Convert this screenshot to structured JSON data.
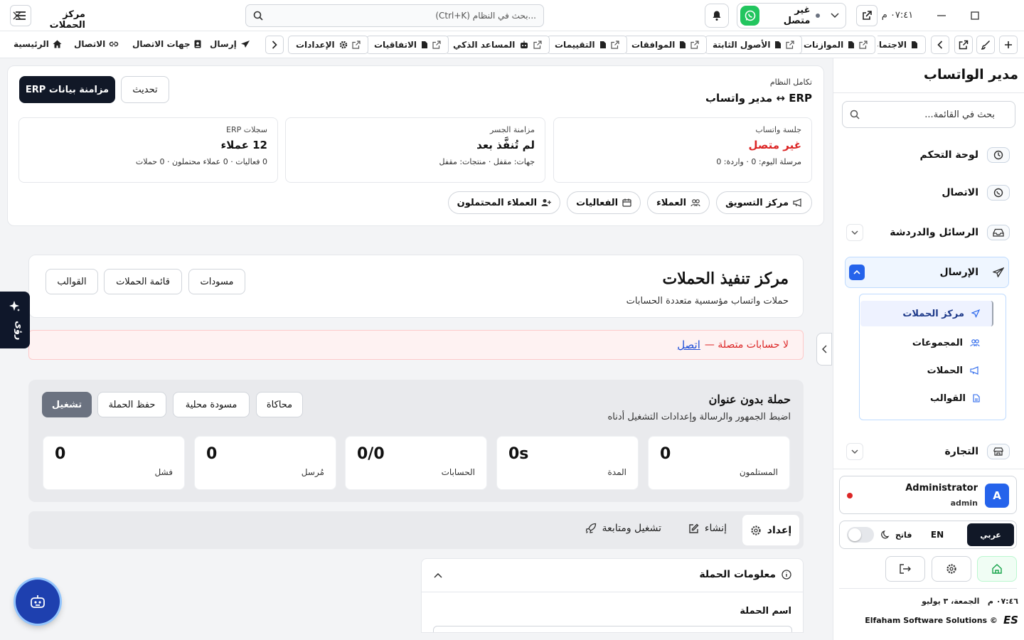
{
  "titlebar": {
    "app_title": "مركز الحملات",
    "search_placeholder": "...بحث في النظام (Ctrl+K)",
    "whatsapp_status": "غير متصل",
    "clock": "٠٧:٤١ م"
  },
  "tabs": {
    "items": [
      "الإعدادات",
      "الاتفاقيات",
      "المساعد الذكي",
      "التقييمات",
      "الموافقات",
      "الأصول الثابتة",
      "الموازنات",
      "الاجتماعات"
    ],
    "nav_links": [
      "الرئيسية",
      "الاتصال",
      "جهات الاتصال",
      "إرسال"
    ]
  },
  "sidebar": {
    "title": "مدير الواتساب",
    "search_placeholder": "بحث في القائمة...",
    "menu": [
      "لوحة التحكم",
      "الاتصال",
      "الرسائل والدردشة",
      "الإرسال",
      "التجارة"
    ],
    "submenu": [
      "مركز الحملات",
      "المجموعات",
      "الحملات",
      "القوالب"
    ],
    "user_name": "Administrator",
    "user_role": "admin",
    "avatar_letter": "A",
    "lang_ar": "عربي",
    "lang_en": "EN",
    "theme_label": "فاتح",
    "date_time": "٠٧:٤٦ م   الجمعة، ٣ يوليو",
    "footer": "Elfaham Software Solutions ©",
    "footer_logo": "ES"
  },
  "integration": {
    "subtitle": "تكامل النظام",
    "title": "ERP ↔ مدير واتساب",
    "refresh_label": "تحديث",
    "sync_label": "مزامنة بيانات ERP",
    "stats": [
      {
        "label": "جلسة واتساب",
        "value": "غير متصل",
        "sub": "مرسلة اليوم: 0 · واردة: 0"
      },
      {
        "label": "مزامنة الجسر",
        "value": "لم تُنفَّذ بعد",
        "sub": "جهات: مقفل · منتجات: مقفل"
      },
      {
        "label": "سجلات ERP",
        "value": "12 عملاء",
        "sub": "0 فعاليات · 0 عملاء محتملون · 0 حملات"
      }
    ],
    "pills": [
      "مركز التسويق",
      "العملاء",
      "الفعاليات",
      "العملاء المحتملون"
    ]
  },
  "campaign_center": {
    "title": "مركز تنفيذ الحملات",
    "subtitle": "حملات واتساب مؤسسية متعددة الحسابات",
    "buttons": [
      "مسودات",
      "قائمة الحملات",
      "القوالب"
    ]
  },
  "alert": {
    "text": "لا حسابات متصلة —",
    "link": "اتصل"
  },
  "campaign": {
    "title": "حملة بدون عنوان",
    "subtitle": "اضبط الجمهور والرسالة وإعدادات التشغيل أدناه",
    "buttons": {
      "simulate": "محاكاة",
      "draft": "مسودة محلية",
      "save": "حفظ الحملة",
      "run": "تشغيل"
    },
    "metrics": [
      {
        "value": "0",
        "label": "المستلمون"
      },
      {
        "value": "0s",
        "label": "المدة"
      },
      {
        "value": "0/0",
        "label": "الحسابات"
      },
      {
        "value": "0",
        "label": "مُرسل"
      },
      {
        "value": "0",
        "label": "فشل"
      }
    ]
  },
  "steps": [
    "إعداد",
    "إنشاء",
    "تشغيل ومتابعة"
  ],
  "info": {
    "title": "معلومات الحملة",
    "field_label": "اسم الحملة"
  },
  "side_widget": "رؤى",
  "colors": {
    "accent": "#111827",
    "danger": "#dc2626",
    "link": "#1d4ed8",
    "blue": "#2563eb",
    "whatsapp": "#22c55e"
  }
}
